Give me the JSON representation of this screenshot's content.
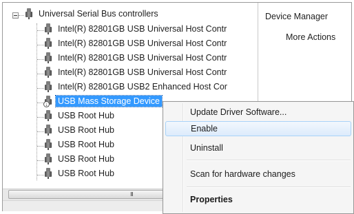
{
  "tree": {
    "root_label": "Universal Serial Bus controllers",
    "children": [
      {
        "label": "Intel(R) 82801GB USB Universal Host Contr",
        "state": "normal"
      },
      {
        "label": "Intel(R) 82801GB USB Universal Host Contr",
        "state": "normal"
      },
      {
        "label": "Intel(R) 82801GB USB Universal Host Contr",
        "state": "normal"
      },
      {
        "label": "Intel(R) 82801GB USB Universal Host Contr",
        "state": "normal"
      },
      {
        "label": "Intel(R) 82801GB USB2 Enhanced Host Cor",
        "state": "normal"
      },
      {
        "label": "USB Mass Storage Device",
        "state": "disabled-selected"
      },
      {
        "label": "USB Root Hub",
        "state": "normal"
      },
      {
        "label": "USB Root Hub",
        "state": "normal"
      },
      {
        "label": "USB Root Hub",
        "state": "normal"
      },
      {
        "label": "USB Root Hub",
        "state": "normal"
      },
      {
        "label": "USB Root Hub",
        "state": "normal"
      }
    ],
    "scroll_grip": "III"
  },
  "actions": {
    "title": "Device Manager",
    "more": "More Actions"
  },
  "context_menu": {
    "items": [
      {
        "label": "Update Driver Software..."
      },
      {
        "label": "Enable"
      },
      {
        "label": "Uninstall"
      },
      {
        "label": "Scan for hardware changes"
      },
      {
        "label": "Properties"
      }
    ],
    "hovered_item": "Enable",
    "default_item": "Properties"
  },
  "colors": {
    "selection": "#3399ff",
    "menu_hover": "#dcebfc"
  },
  "icons": {
    "device": "usb-plug-icon",
    "disabled_badge": "disabled-down-arrow-icon",
    "expander": "collapse-minus-icon"
  }
}
